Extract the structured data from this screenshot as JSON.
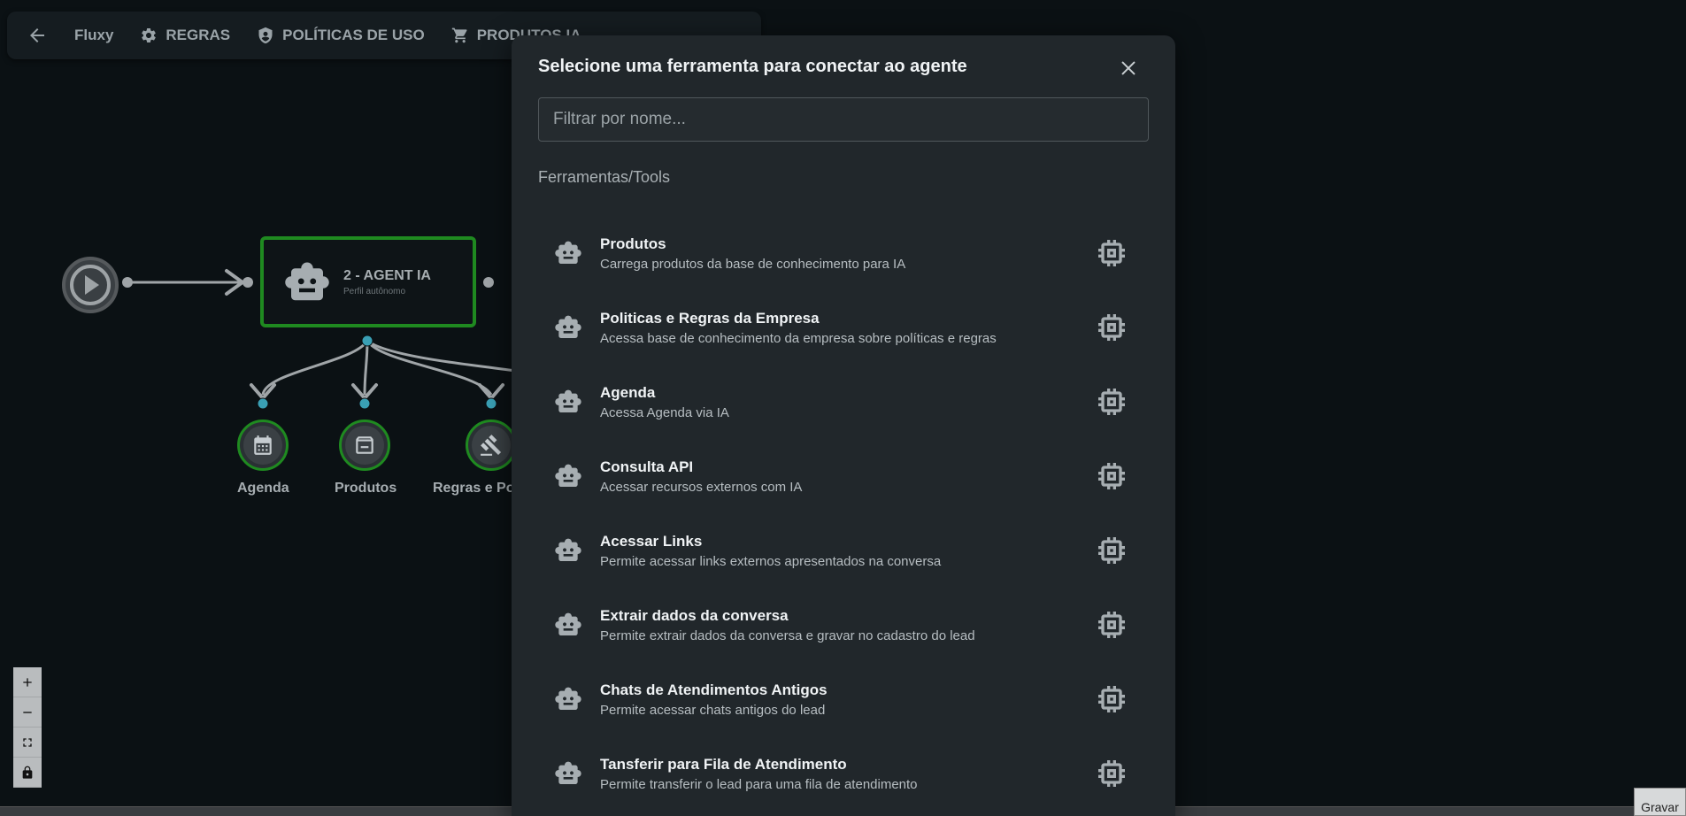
{
  "toolbar": {
    "brand": "Fluxy",
    "regras": "REGRAS",
    "politicas": "POLÍTICAS DE USO",
    "produtos": "PRODUTOS IA"
  },
  "flow": {
    "agent_title": "2 - AGENT IA",
    "agent_subtitle": "Perfil autônomo",
    "tools": [
      {
        "label": "Agenda",
        "icon": "calendar-icon"
      },
      {
        "label": "Produtos",
        "icon": "archive-icon"
      },
      {
        "label": "Regras e Po",
        "icon": "gavel-icon"
      }
    ]
  },
  "modal": {
    "title": "Selecione uma ferramenta para conectar ao agente",
    "filter_placeholder": "Filtrar por nome...",
    "section_label": "Ferramentas/Tools",
    "items": [
      {
        "name": "Produtos",
        "description": "Carrega produtos da base de conhecimento para IA"
      },
      {
        "name": "Politicas e Regras da Empresa",
        "description": "Acessa base de conhecimento da empresa sobre políticas e regras"
      },
      {
        "name": "Agenda",
        "description": "Acessa Agenda via IA"
      },
      {
        "name": "Consulta API",
        "description": "Acessar recursos externos com IA"
      },
      {
        "name": "Acessar Links",
        "description": "Permite acessar links externos apresentados na conversa"
      },
      {
        "name": "Extrair dados da conversa",
        "description": "Permite extrair dados da conversa e gravar no cadastro do lead"
      },
      {
        "name": "Chats de Atendimentos Antigos",
        "description": "Permite acessar chats antigos do lead"
      },
      {
        "name": "Tansferir para Fila de Atendimento",
        "description": "Permite transferir o lead para uma fila de atendimento"
      }
    ]
  },
  "footer": {
    "save_label": "Gravar"
  },
  "colors": {
    "accent_green": "#1f8a20",
    "modal_bg": "#21272b",
    "canvas_bg": "#0b1114"
  }
}
